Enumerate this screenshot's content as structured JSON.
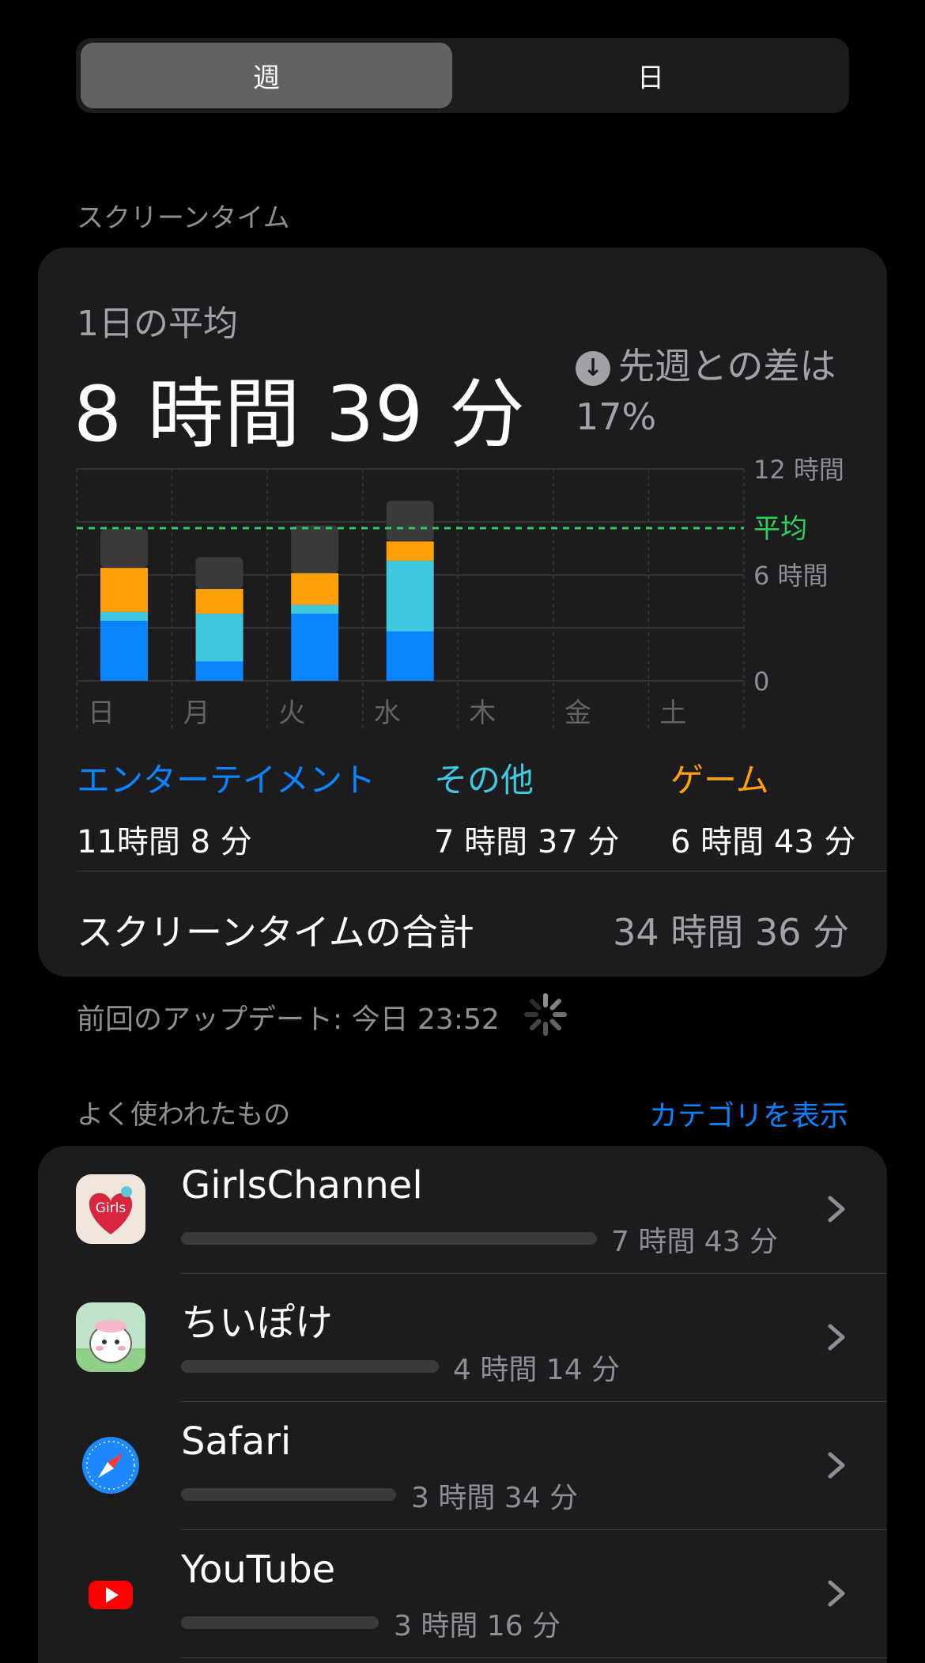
{
  "segment": {
    "week": "週",
    "day": "日"
  },
  "screen_time_label": "スクリーンタイム",
  "summary": {
    "avg_label": "1日の平均",
    "avg_value": "8 時間 39 分",
    "diff_text": "先週との差は",
    "diff_value": "17%",
    "diff_icon": "arrow-down-circle-icon"
  },
  "chart_data": {
    "type": "bar",
    "categories": [
      "日",
      "月",
      "火",
      "水",
      "木",
      "金",
      "土"
    ],
    "series": [
      {
        "name": "エンターテイメント",
        "values": [
          3.4,
          1.1,
          3.8,
          2.8,
          0,
          0,
          0
        ]
      },
      {
        "name": "その他",
        "values": [
          0.5,
          2.7,
          0.5,
          4.0,
          0,
          0,
          0
        ]
      },
      {
        "name": "ゲーム",
        "values": [
          2.5,
          1.4,
          1.8,
          1.1,
          0,
          0,
          0
        ]
      },
      {
        "values": [
          2.2,
          1.8,
          2.7,
          2.3,
          0,
          0,
          0
        ]
      }
    ],
    "ylim": [
      0,
      12
    ],
    "y_ticks": [
      "12 時間",
      "6 時間",
      "0"
    ],
    "average": {
      "label": "平均",
      "value": 8.65
    },
    "colors": [
      "#0a84ff",
      "#40c8e0",
      "#ff9f0a",
      "#3a3a3c"
    ],
    "average_color": "#30d158"
  },
  "categories": [
    {
      "name": "エンターテイメント",
      "time": "11時間 8 分",
      "color": "#0a84ff"
    },
    {
      "name": "その他",
      "time": "7 時間 37 分",
      "color": "#40c8e0"
    },
    {
      "name": "ゲーム",
      "time": "6 時間 43 分",
      "color": "#ff9f0a"
    }
  ],
  "total": {
    "label": "スクリーンタイムの合計",
    "value": "34 時間 36 分"
  },
  "updated": "前回のアップデート: 今日 23:52",
  "most_used": {
    "label": "よく使われたもの",
    "show_categories": "カテゴリを表示"
  },
  "apps": [
    {
      "name": "GirlsChannel",
      "time": "7 時間 43 分",
      "icon": "girlschannel-icon",
      "bar": 1.0
    },
    {
      "name": "ちいぽけ",
      "time": "4 時間 14 分",
      "icon": "chiipoke-icon",
      "bar": 0.62
    },
    {
      "name": "Safari",
      "time": "3 時間 34 分",
      "icon": "safari-icon",
      "bar": 0.52
    },
    {
      "name": "YouTube",
      "time": "3 時間 16 分",
      "icon": "youtube-icon",
      "bar": 0.48
    }
  ]
}
